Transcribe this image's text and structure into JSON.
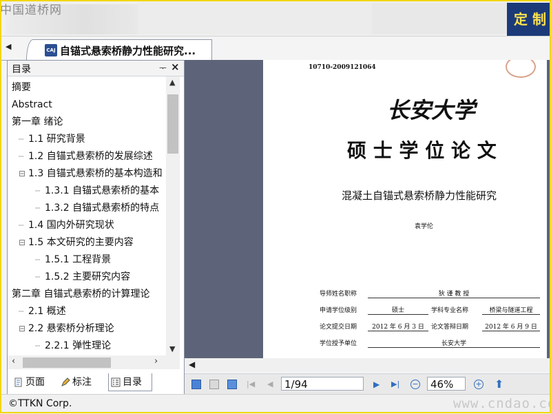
{
  "banner": {
    "watermark": "中国道桥网",
    "ad_text": "定 制"
  },
  "tabs": {
    "nav_symbol": "◀",
    "doc_title": "自锚式悬索桥静力性能研究..."
  },
  "panel": {
    "title": "目录",
    "pin": "ᅮ",
    "close": "×",
    "tree": [
      {
        "label": "摘要",
        "level": 0,
        "conn": false,
        "expand": ""
      },
      {
        "label": "Abstract",
        "level": 0,
        "conn": false,
        "expand": ""
      },
      {
        "label": "第一章 绪论",
        "level": 0,
        "conn": false,
        "expand": ""
      },
      {
        "label": "1.1 研究背景",
        "level": 1,
        "conn": true,
        "expand": ""
      },
      {
        "label": "1.2 自锚式悬索桥的发展综述",
        "level": 1,
        "conn": true,
        "expand": ""
      },
      {
        "label": "1.3 自锚式悬索桥的基本构造和",
        "level": 1,
        "conn": true,
        "expand": "⊟"
      },
      {
        "label": "1.3.1 自锚式悬索桥的基本",
        "level": 2,
        "conn": true,
        "expand": ""
      },
      {
        "label": "1.3.2 自锚式悬索桥的特点",
        "level": 2,
        "conn": true,
        "expand": ""
      },
      {
        "label": "1.4 国内外研究现状",
        "level": 1,
        "conn": true,
        "expand": ""
      },
      {
        "label": "1.5 本文研究的主要内容",
        "level": 1,
        "conn": true,
        "expand": "⊟"
      },
      {
        "label": "1.5.1 工程背景",
        "level": 2,
        "conn": true,
        "expand": ""
      },
      {
        "label": "1.5.2 主要研究内容",
        "level": 2,
        "conn": true,
        "expand": ""
      },
      {
        "label": "第二章 自锚式悬索桥的计算理论",
        "level": 0,
        "conn": false,
        "expand": ""
      },
      {
        "label": "2.1 概述",
        "level": 1,
        "conn": true,
        "expand": ""
      },
      {
        "label": "2.2 悬索桥分析理论",
        "level": 1,
        "conn": true,
        "expand": "⊟"
      },
      {
        "label": "2.2.1 弹性理论",
        "level": 2,
        "conn": true,
        "expand": ""
      }
    ],
    "scroll_up": "▲",
    "scroll_down": "▼",
    "scroll_left": "‹",
    "scroll_right": "›",
    "bottom_tabs": [
      {
        "label": "页面",
        "icon": "page-icon",
        "active": false
      },
      {
        "label": "标注",
        "icon": "pen-icon",
        "active": false
      },
      {
        "label": "目录",
        "icon": "toc-icon",
        "active": true
      }
    ]
  },
  "document": {
    "serial": "10710-2009121064",
    "university": "长安大学",
    "degree": "硕 士 学 位 论 文",
    "thesis_title": "混凝土自锚式悬索桥静力性能研究",
    "author": "袁学伦",
    "rows": [
      {
        "k1": "导师姓名职称",
        "v1": "狄 谨 教 授",
        "k2": "",
        "v2": ""
      },
      {
        "k1": "申请学位级别",
        "v1": "硕士",
        "k2": "学科专业名称",
        "v2": "桥梁与隧道工程"
      },
      {
        "k1": "论文提交日期",
        "v1": "2012 年 6 月 3 日",
        "k2": "论文答辩日期",
        "v2": "2012 年 6 月 9 日"
      },
      {
        "k1": "学位授予单位",
        "v1": "长安大学",
        "k2": "",
        "v2": ""
      }
    ]
  },
  "viewer_scroll_left": "◀",
  "toolbar": {
    "page_value": "1/94",
    "zoom_value": "46%",
    "play": "▶",
    "last": "▶|",
    "minus": "−",
    "plus": "+",
    "up": "⬆"
  },
  "status": {
    "copyright": "©TTKN Corp.",
    "watermark": "www.cndao.com"
  },
  "colors": {
    "accent": "#2f6fbf",
    "viewer_bg": "#5d6479",
    "border": "#f2d700"
  }
}
